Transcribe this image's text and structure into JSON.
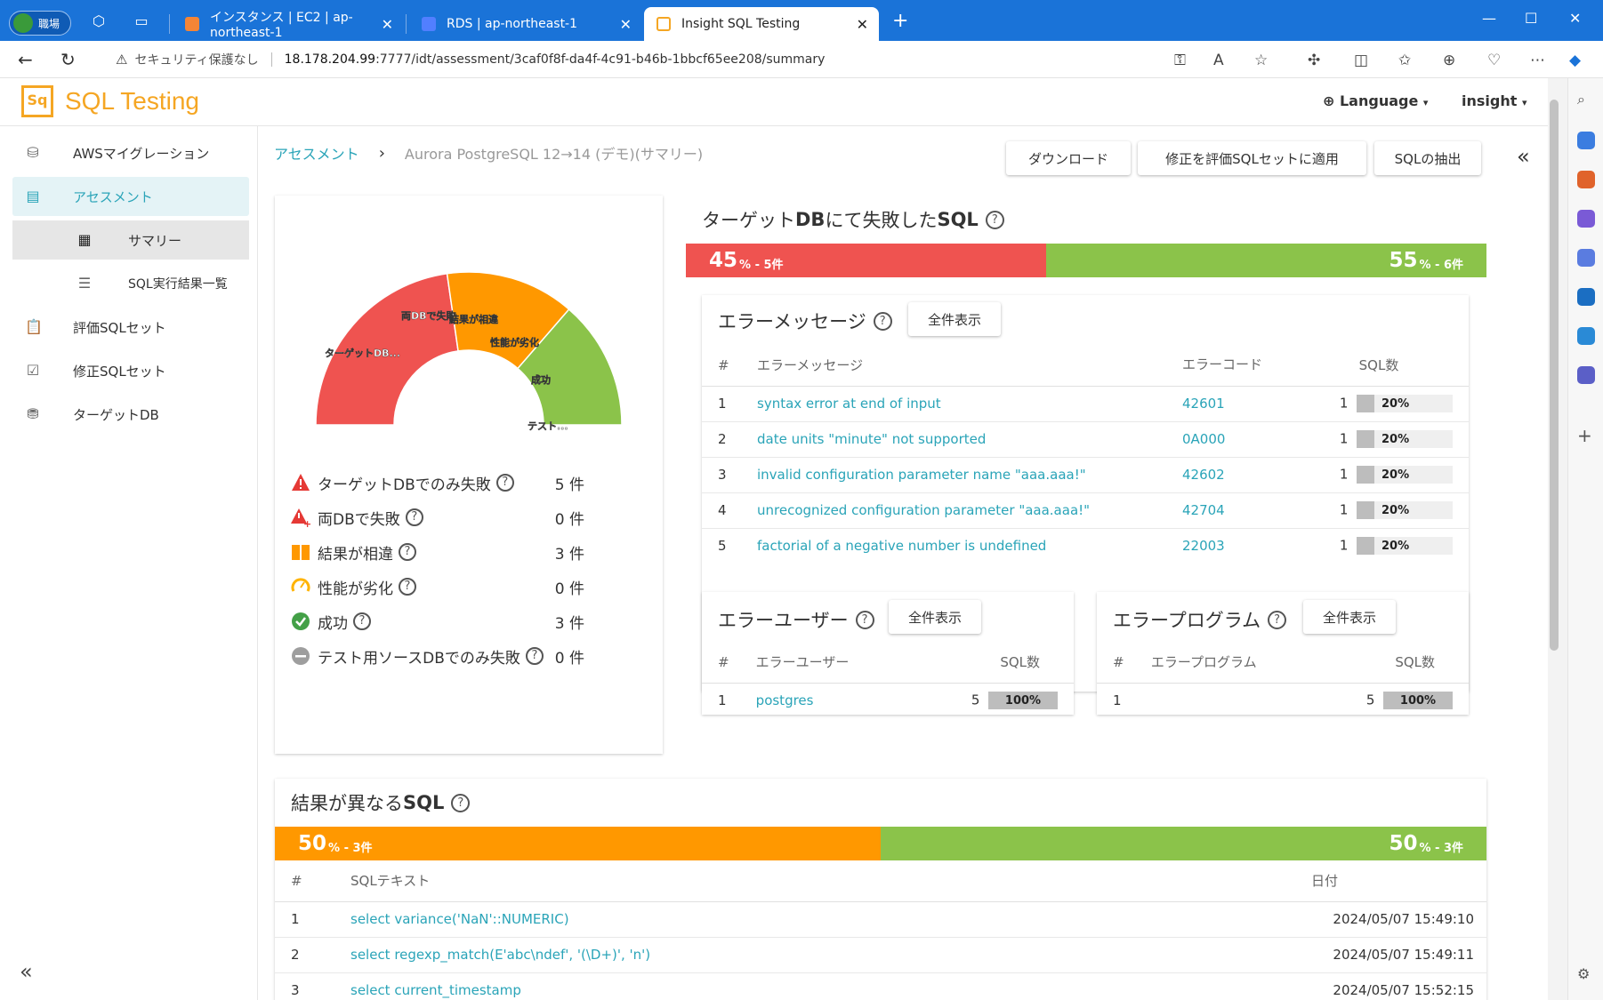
{
  "browser": {
    "profile_label": "職場",
    "tabs": [
      {
        "title": "インスタンス | EC2 | ap-northeast-1",
        "color": "#f58536"
      },
      {
        "title": "RDS | ap-northeast-1",
        "color": "#527fff"
      },
      {
        "title": "Insight SQL Testing",
        "color": "#f5a623"
      }
    ],
    "security_label": "セキュリティ保護なし",
    "url_host": "18.178.204.99",
    "url_rest": ":7777/idt/assessment/3caf0f8f-da4f-4c91-b46b-1bbcf65ee208/summary"
  },
  "app": {
    "logo_mark": "Sq",
    "logo_text": "SQL Testing",
    "language_label": "Language",
    "user_label": "insight"
  },
  "sidebar": {
    "items": [
      {
        "label": "AWSマイグレーション",
        "icon": "database-migrate-icon"
      },
      {
        "label": "アセスメント",
        "icon": "document-icon"
      },
      {
        "label": "サマリー",
        "icon": "dashboard-icon"
      },
      {
        "label": "SQL実行結果一覧",
        "icon": "list-icon"
      },
      {
        "label": "評価SQLセット",
        "icon": "clipboard-icon"
      },
      {
        "label": "修正SQLセット",
        "icon": "clipboard-check-icon"
      },
      {
        "label": "ターゲットDB",
        "icon": "database-icon"
      }
    ]
  },
  "breadcrumb": {
    "parent": "アセスメント",
    "separator": "›",
    "current": "Aurora PostgreSQL 12→14 (デモ)(サマリー)"
  },
  "actions": {
    "download": "ダウンロード",
    "apply_fix": "修正を評価SQLセットに適用",
    "extract_sql": "SQLの抽出"
  },
  "gauge": {
    "labels": [
      "ターゲットDB...",
      "両DBで失敗",
      "結果が相違",
      "性能が劣化",
      "成功",
      "テスト..."
    ],
    "colors": {
      "fail": "#ef5350",
      "diff": "#ff9800",
      "success": "#8bc34a"
    }
  },
  "summary": [
    {
      "label": "ターゲットDBでのみ失敗",
      "count": "5 件",
      "icon": "warning-icon"
    },
    {
      "label": "両DBで失敗",
      "count": "0 件",
      "icon": "warning-plus-icon"
    },
    {
      "label": "結果が相違",
      "count": "3 件",
      "icon": "diff-icon"
    },
    {
      "label": "性能が劣化",
      "count": "0 件",
      "icon": "speed-icon"
    },
    {
      "label": "成功",
      "count": "3 件",
      "icon": "check-circle-icon"
    },
    {
      "label": "テスト用ソースDBでのみ失敗",
      "count": "0 件",
      "icon": "minus-circle-icon"
    }
  ],
  "failed_sql": {
    "title_prefix": "ターゲット",
    "title_bold": "DB",
    "title_mid": "にて失敗した",
    "title_bold2": "SQL",
    "fail_pct": "45",
    "fail_suffix": "% - 5件",
    "fail_fraction": 0.45,
    "ok_pct": "55",
    "ok_suffix": "% - 6件"
  },
  "error_messages": {
    "title": "エラーメッセージ",
    "show_all": "全件表示",
    "headers": [
      "#",
      "エラーメッセージ",
      "エラーコード",
      "SQL数"
    ],
    "rows": [
      {
        "no": "1",
        "message": "syntax error at end of input",
        "code": "42601",
        "count": "1",
        "pct": "20%"
      },
      {
        "no": "2",
        "message": "date units \"minute\" not supported",
        "code": "0A000",
        "count": "1",
        "pct": "20%"
      },
      {
        "no": "3",
        "message": "invalid configuration parameter name \"aaa.aaa!\"",
        "code": "42602",
        "count": "1",
        "pct": "20%"
      },
      {
        "no": "4",
        "message": "unrecognized configuration parameter \"aaa.aaa!\"",
        "code": "42704",
        "count": "1",
        "pct": "20%"
      },
      {
        "no": "5",
        "message": "factorial of a negative number is undefined",
        "code": "22003",
        "count": "1",
        "pct": "20%"
      }
    ]
  },
  "error_users": {
    "title": "エラーユーザー",
    "show_all": "全件表示",
    "headers": [
      "#",
      "エラーユーザー",
      "SQL数"
    ],
    "rows": [
      {
        "no": "1",
        "user": "postgres",
        "count": "5",
        "pct": "100%"
      }
    ]
  },
  "error_programs": {
    "title": "エラープログラム",
    "show_all": "全件表示",
    "headers": [
      "#",
      "エラープログラム",
      "SQL数"
    ],
    "rows": [
      {
        "no": "1",
        "program": "",
        "count": "5",
        "pct": "100%"
      }
    ]
  },
  "diff_sql": {
    "title_prefix": "結果が異なる",
    "title_bold": "SQL",
    "diff_pct": "50",
    "diff_suffix": "% - 3件",
    "diff_fraction": 0.5,
    "same_pct": "50",
    "same_suffix": "% - 3件",
    "headers": [
      "#",
      "SQLテキスト",
      "日付"
    ],
    "rows": [
      {
        "no": "1",
        "sql": "select variance('NaN'::NUMERIC)",
        "date": "2024/05/07 15:49:10"
      },
      {
        "no": "2",
        "sql": "select regexp_match(E'abc\\ndef', '(\\D+)', 'n')",
        "date": "2024/05/07 15:49:11"
      },
      {
        "no": "3",
        "sql": "select current_timestamp",
        "date": "2024/05/07 15:52:15"
      }
    ]
  }
}
